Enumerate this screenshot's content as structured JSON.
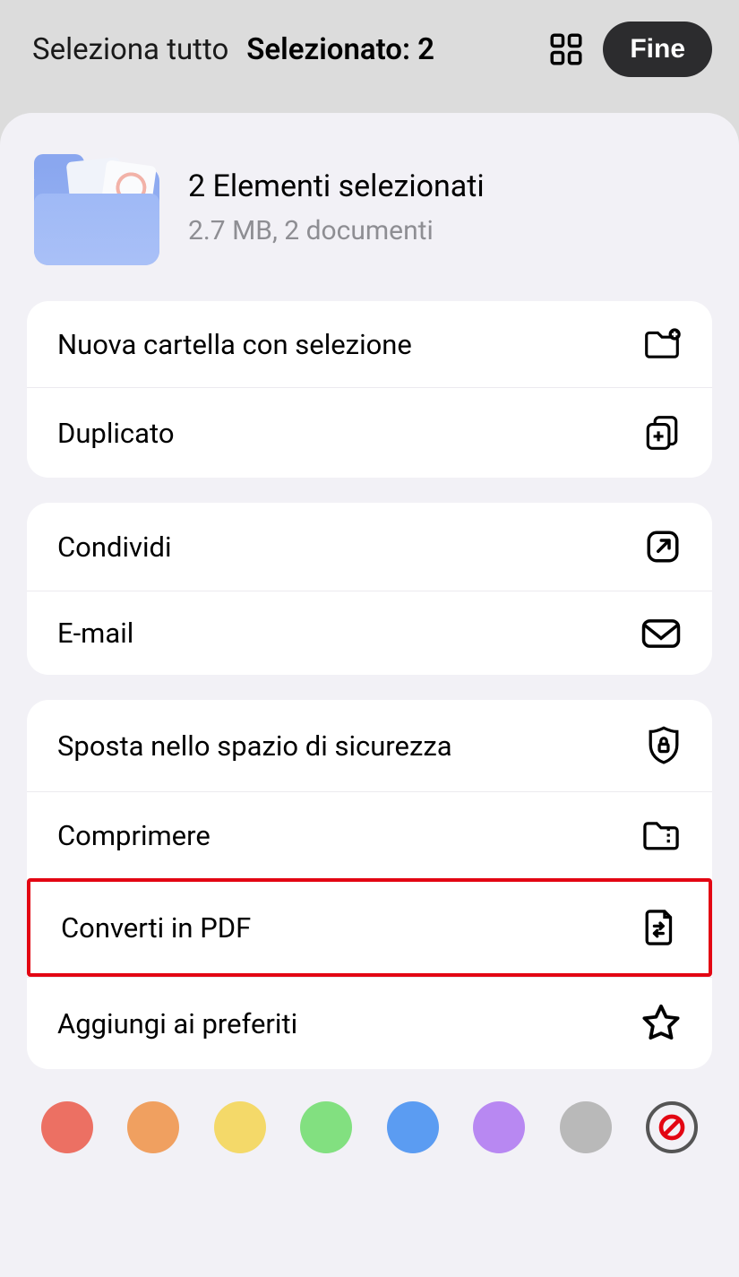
{
  "topbar": {
    "select_all": "Seleziona tutto",
    "selected": "Selezionato: 2",
    "done": "Fine"
  },
  "sheet": {
    "title": "2 Elementi selezionati",
    "subtitle": "2.7 MB, 2 documenti"
  },
  "group1": {
    "new_folder": "Nuova cartella con selezione",
    "duplicate": "Duplicato"
  },
  "group2": {
    "share": "Condividi",
    "email": "E-mail"
  },
  "group3": {
    "safe_space": "Sposta nello spazio di sicurezza",
    "compress": "Comprimere",
    "convert_pdf": "Converti in PDF",
    "favorite": "Aggiungi ai preferiti"
  },
  "tags": {
    "colors": [
      "#ec7063",
      "#f0a060",
      "#f4d969",
      "#82e080",
      "#5b9cf2",
      "#b888f2",
      "#b9b9b9"
    ]
  }
}
